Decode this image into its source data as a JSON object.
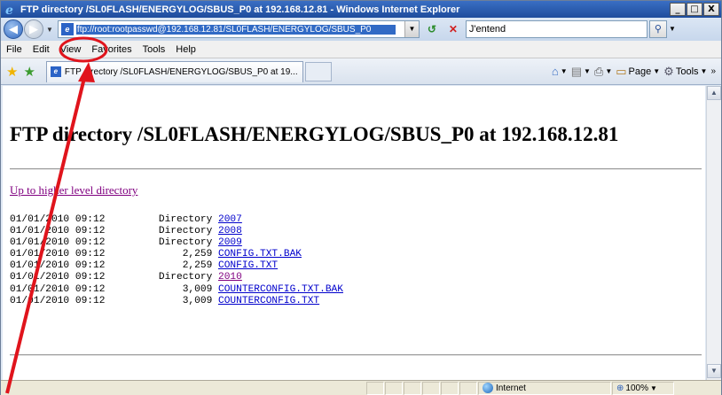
{
  "window": {
    "title": "FTP directory /SL0FLASH/ENERGYLOG/SBUS_P0 at 192.168.12.81 - Windows Internet Explorer",
    "minimize": "_",
    "maximize": "□",
    "close": "X"
  },
  "address": {
    "url": "ftp://root:rootpasswd@192.168.12.81/SL0FLASH/ENERGYLOG/SBUS_P0",
    "search_value": "J'entend"
  },
  "menu": {
    "items": [
      "File",
      "Edit",
      "View",
      "Favorites",
      "Tools",
      "Help"
    ]
  },
  "tabs": {
    "active_label": "FTP directory /SL0FLASH/ENERGYLOG/SBUS_P0 at 19..."
  },
  "command_bar": {
    "page_label": "Page",
    "tools_label": "Tools"
  },
  "page": {
    "title": "FTP directory /SL0FLASH/ENERGYLOG/SBUS_P0 at 192.168.12.81",
    "up_link": "Up to higher level directory",
    "rows": [
      {
        "date": "01/01/2010 09:12",
        "info": " Directory ",
        "name": "2007",
        "visited": false
      },
      {
        "date": "01/01/2010 09:12",
        "info": " Directory ",
        "name": "2008",
        "visited": false
      },
      {
        "date": "01/01/2010 09:12",
        "info": " Directory ",
        "name": "2009",
        "visited": false
      },
      {
        "date": "01/01/2010 09:12",
        "info": "     2,259 ",
        "name": "CONFIG.TXT.BAK",
        "visited": false
      },
      {
        "date": "01/01/2010 09:12",
        "info": "     2,259 ",
        "name": "CONFIG.TXT",
        "visited": false
      },
      {
        "date": "01/01/2010 09:12",
        "info": " Directory ",
        "name": "2010",
        "visited": true
      },
      {
        "date": "01/01/2010 09:12",
        "info": "     3,009 ",
        "name": "COUNTERCONFIG.TXT.BAK",
        "visited": false
      },
      {
        "date": "01/01/2010 09:12",
        "info": "     3,009 ",
        "name": "COUNTERCONFIG.TXT",
        "visited": false
      }
    ]
  },
  "status": {
    "zone": "Internet",
    "zoom": "100%"
  },
  "colors": {
    "annotation": "#e0141c",
    "visited_link": "#800080",
    "link": "#0000cc"
  },
  "annotation": {
    "highlighted_item": "View"
  }
}
